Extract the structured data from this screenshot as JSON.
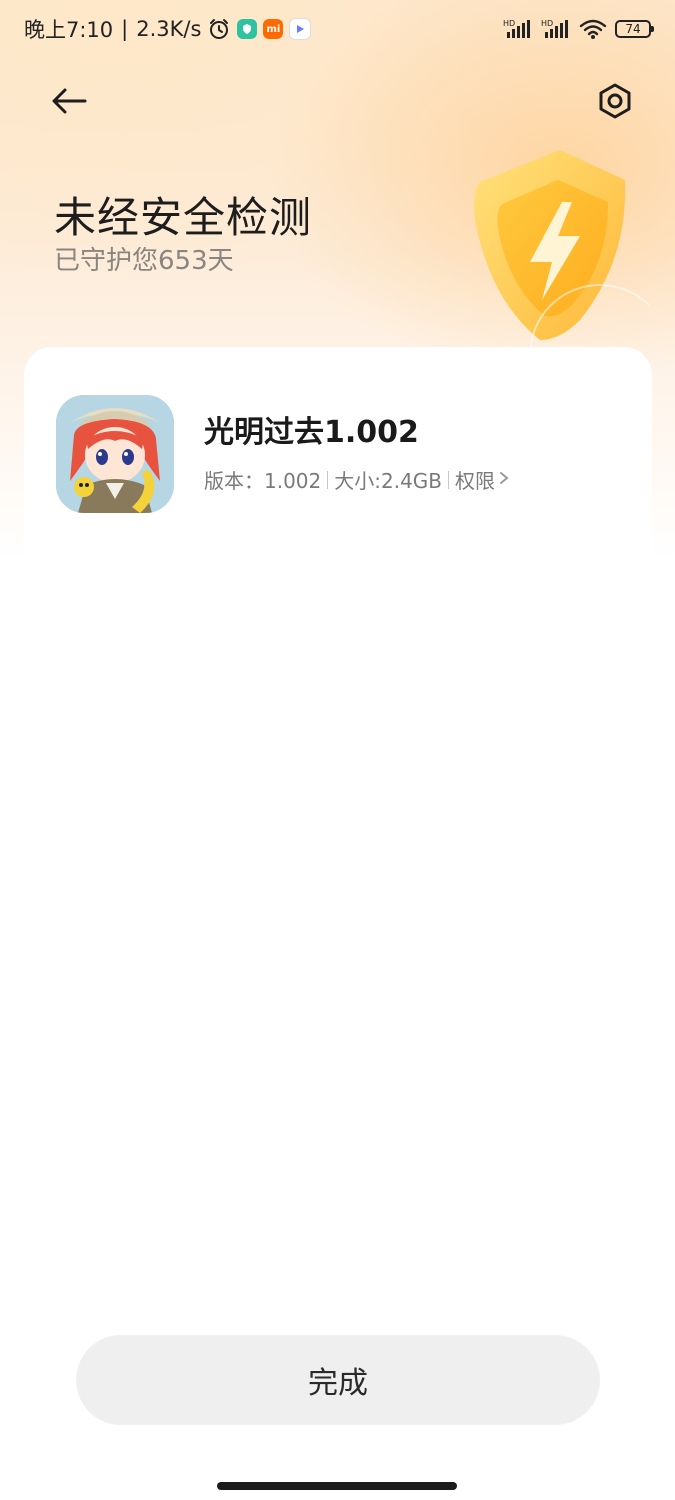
{
  "status_bar": {
    "time": "晚上7:10",
    "network_speed": "2.3K/s",
    "battery_level": "74",
    "icons": [
      "alarm-icon",
      "security-app-icon",
      "mi-app-icon",
      "play-app-icon",
      "hd-signal-icon",
      "hd-signal-icon",
      "wifi-icon",
      "battery-icon"
    ]
  },
  "header": {
    "back_icon": "back-arrow-icon",
    "settings_icon": "settings-icon",
    "title": "未经安全检测",
    "subtitle": "已守护您653天"
  },
  "app": {
    "name": "光明过去1.002",
    "version_label": "版本：1.002",
    "size_label": "大小:2.4GB",
    "permission_label": "权限"
  },
  "footer": {
    "done_label": "完成"
  },
  "colors": {
    "hero_gradient_top": "#fde7cc",
    "shield_yellow": "#ffc83a",
    "text_primary": "#1d1d1d",
    "text_secondary": "#8a8580",
    "button_bg": "#efefef"
  }
}
